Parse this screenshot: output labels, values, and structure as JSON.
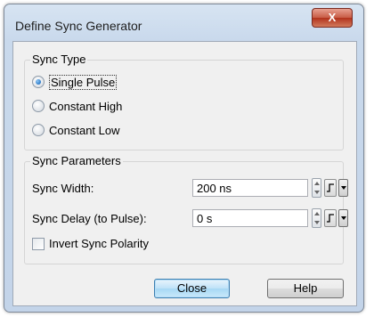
{
  "window": {
    "title": "Define Sync Generator",
    "close_glyph": "X"
  },
  "sync_type": {
    "label": "Sync Type",
    "options": [
      {
        "label": "Single Pulse",
        "selected": true
      },
      {
        "label": "Constant High",
        "selected": false
      },
      {
        "label": "Constant Low",
        "selected": false
      }
    ]
  },
  "sync_params": {
    "label": "Sync Parameters",
    "width_label": "Sync Width:",
    "width_value": "200 ns",
    "delay_label": "Sync Delay (to Pulse):",
    "delay_value": "0 s",
    "invert_label": "Invert Sync Polarity",
    "invert_checked": false
  },
  "buttons": {
    "close": "Close",
    "help": "Help"
  },
  "colors": {
    "default_button": "#a7d8f4",
    "title_close": "#c75b44"
  },
  "icons": [
    "close-icon",
    "spinner-icon",
    "rising-edge-icon",
    "dropdown-arrow-icon"
  ]
}
